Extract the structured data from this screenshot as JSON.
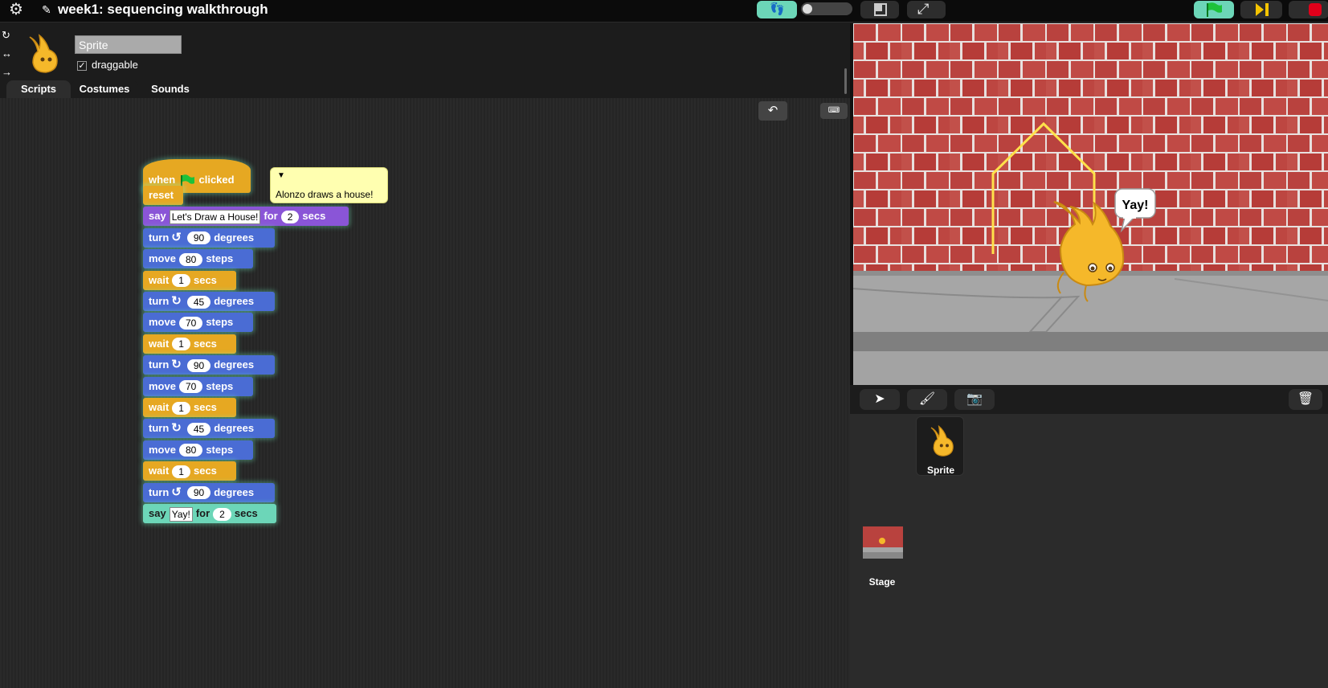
{
  "window": {
    "title": "week1: sequencing walkthrough"
  },
  "sprite": {
    "name": "Sprite",
    "draggable_label": "draggable",
    "draggable_checked": "✓"
  },
  "tabs": [
    "Scripts",
    "Costumes",
    "Sounds"
  ],
  "script": {
    "hat": {
      "when": "when",
      "clicked": "clicked"
    },
    "comment": "Alonzo draws a house!",
    "blocks": [
      {
        "kind": "control",
        "label": "reset"
      },
      {
        "kind": "looks",
        "words": [
          "say",
          "for",
          "secs"
        ],
        "text": "Let's Draw a House!",
        "num": "2"
      },
      {
        "kind": "motion",
        "words": [
          "turn",
          "degrees"
        ],
        "dir": "ccw",
        "num": "90"
      },
      {
        "kind": "motion",
        "words": [
          "move",
          "steps"
        ],
        "num": "80"
      },
      {
        "kind": "control",
        "words": [
          "wait",
          "secs"
        ],
        "num": "1"
      },
      {
        "kind": "motion",
        "words": [
          "turn",
          "degrees"
        ],
        "dir": "cw",
        "num": "45"
      },
      {
        "kind": "motion",
        "words": [
          "move",
          "steps"
        ],
        "num": "70"
      },
      {
        "kind": "control",
        "words": [
          "wait",
          "secs"
        ],
        "num": "1"
      },
      {
        "kind": "motion",
        "words": [
          "turn",
          "degrees"
        ],
        "dir": "cw",
        "num": "90"
      },
      {
        "kind": "motion",
        "words": [
          "move",
          "steps"
        ],
        "num": "70"
      },
      {
        "kind": "control",
        "words": [
          "wait",
          "secs"
        ],
        "num": "1"
      },
      {
        "kind": "motion",
        "words": [
          "turn",
          "degrees"
        ],
        "dir": "cw",
        "num": "45"
      },
      {
        "kind": "motion",
        "words": [
          "move",
          "steps"
        ],
        "num": "80"
      },
      {
        "kind": "control",
        "words": [
          "wait",
          "secs"
        ],
        "num": "1"
      },
      {
        "kind": "motion",
        "words": [
          "turn",
          "degrees"
        ],
        "dir": "ccw",
        "num": "90"
      },
      {
        "kind": "looks",
        "words": [
          "say",
          "for",
          "secs"
        ],
        "text": "Yay!",
        "num": "2"
      }
    ]
  },
  "stage": {
    "speech": "Yay!"
  },
  "corral": {
    "sprite_label": "Sprite",
    "stage_label": "Stage"
  },
  "colors": {
    "motion": "#4a6cd4",
    "control": "#e6a822",
    "looks": "#8a55d7",
    "highlight": "#6cd6b8"
  },
  "icons": [
    "gear-icon",
    "pencil-icon",
    "footprints-icon",
    "stage-size-icon",
    "fullscreen-icon",
    "green-flag-icon",
    "pause-icon",
    "stop-icon",
    "undo-icon",
    "keyboard-icon",
    "turtle-icon",
    "paintbrush-icon",
    "camera-icon",
    "trash-icon"
  ]
}
